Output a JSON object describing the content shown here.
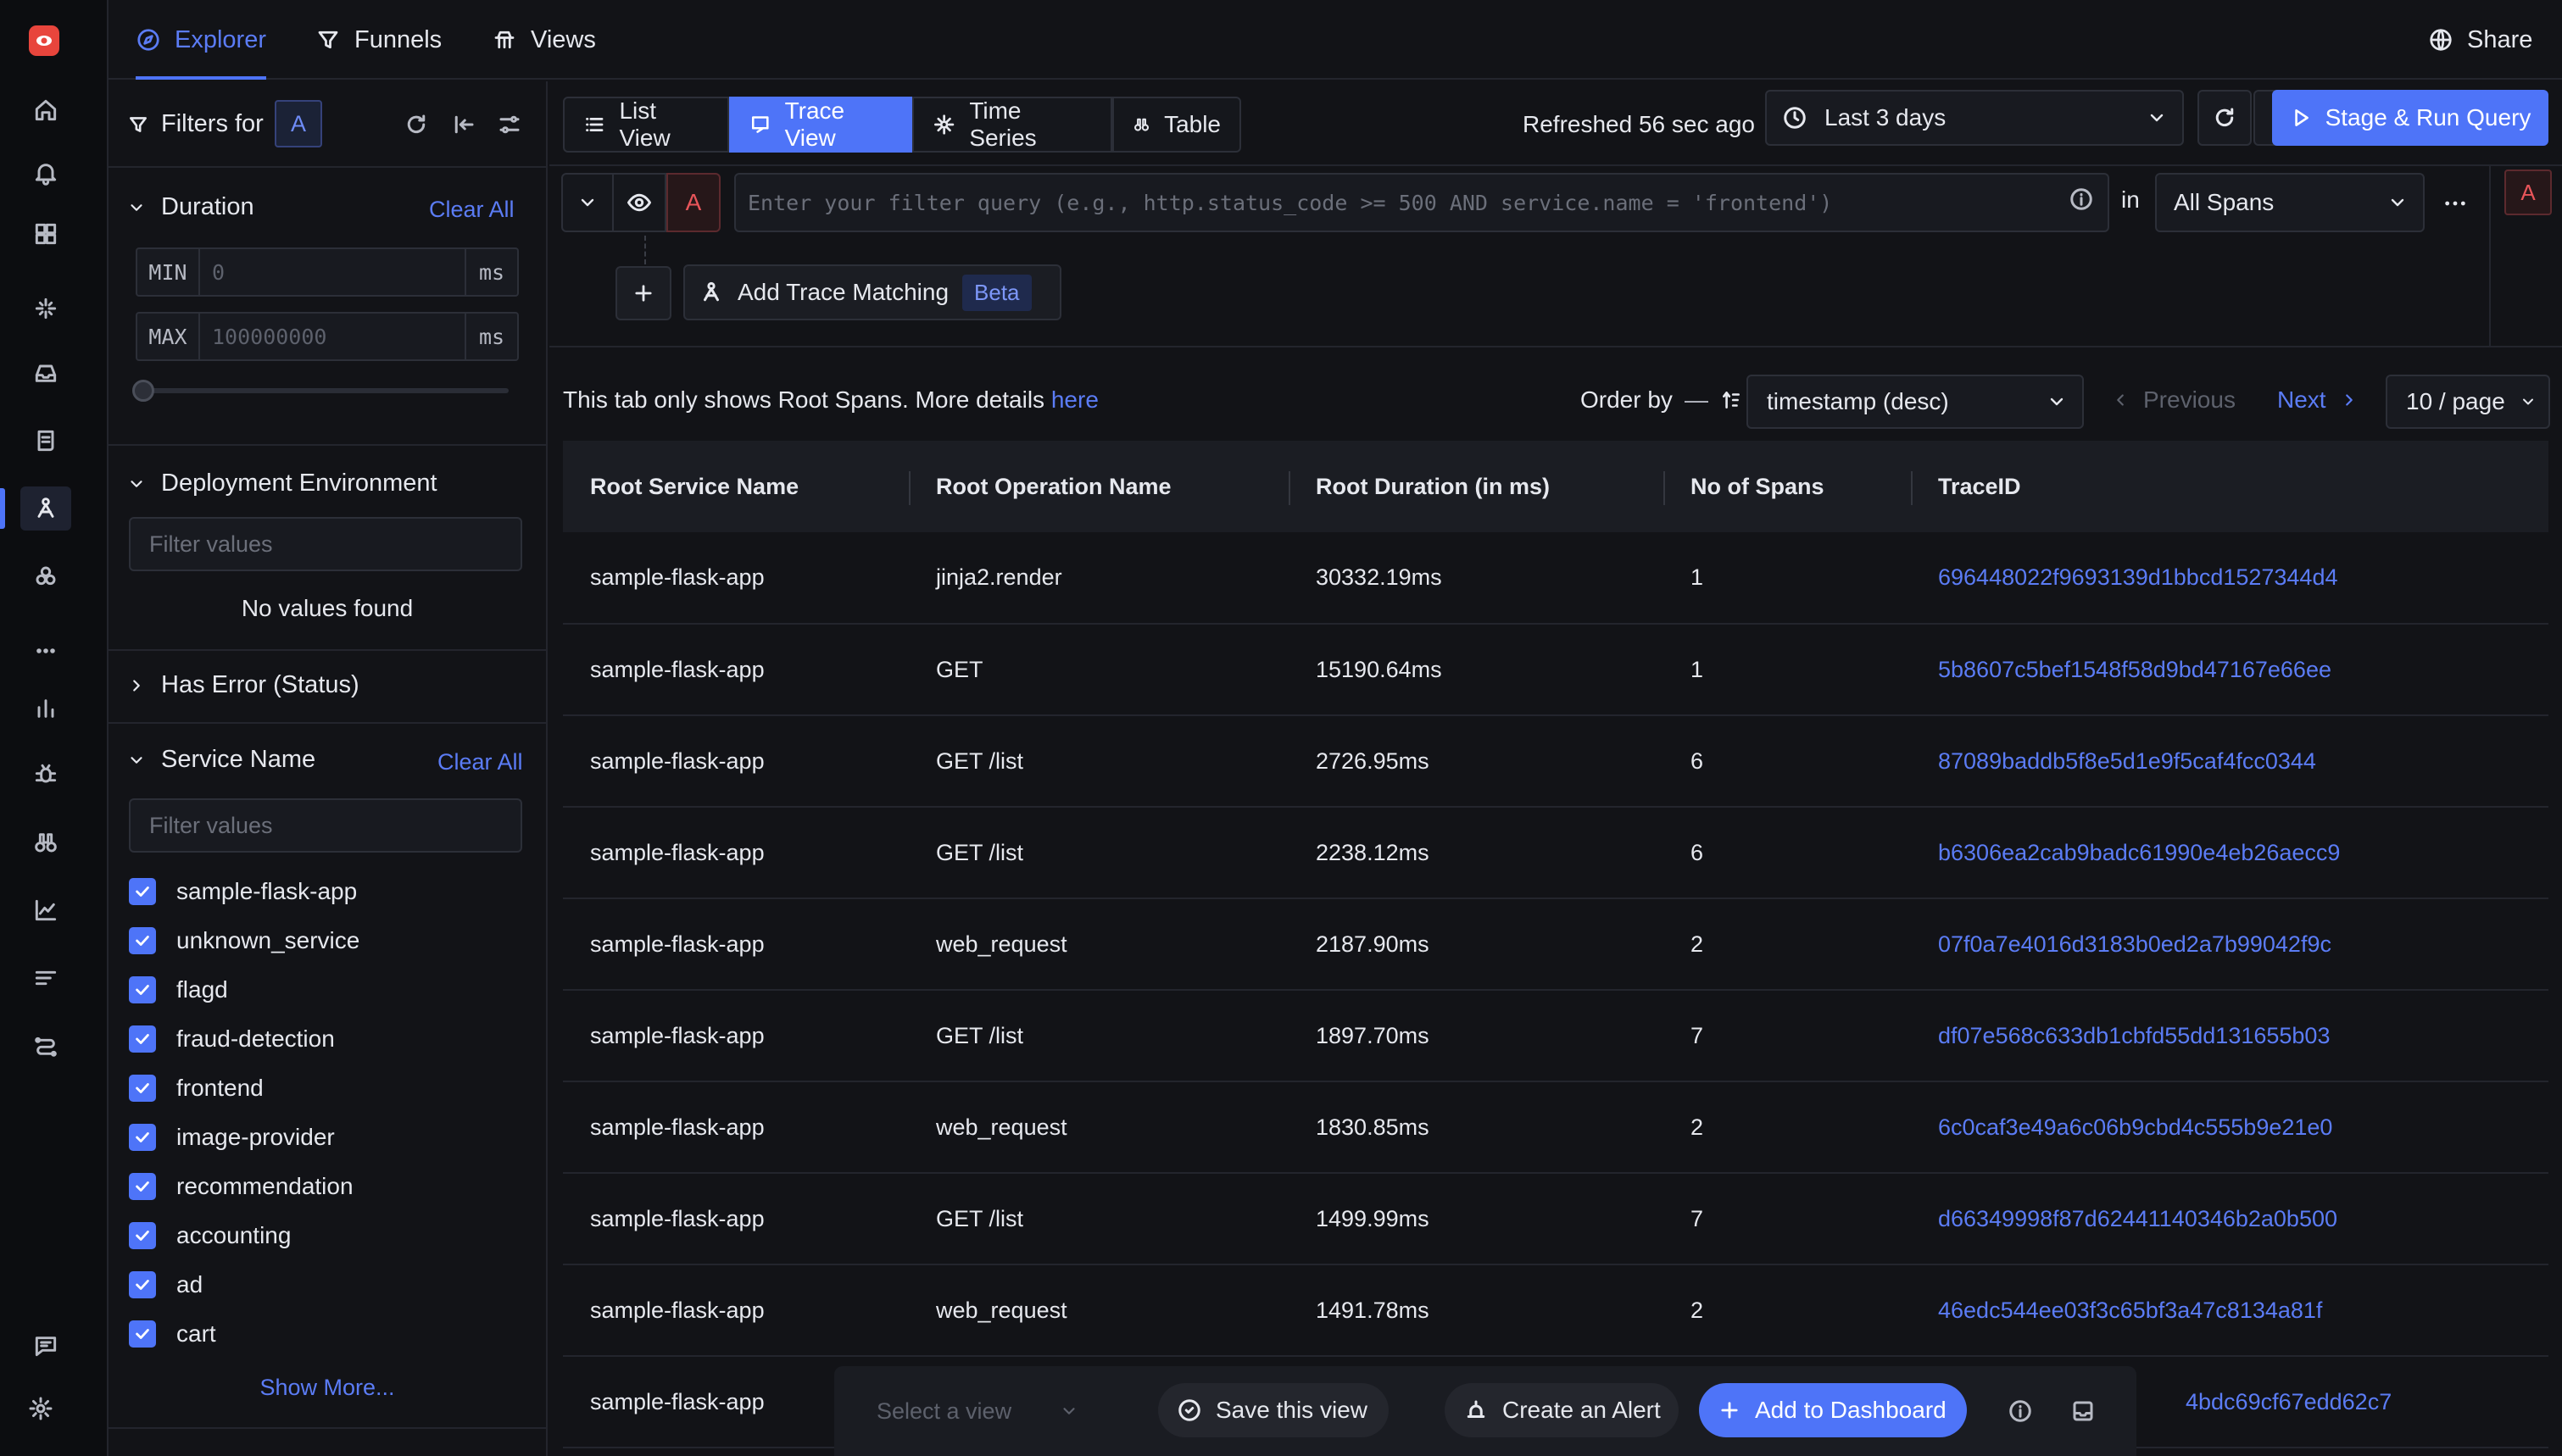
{
  "nav": {
    "tabs": [
      {
        "label": "Explorer",
        "icon": "compass-icon"
      },
      {
        "label": "Funnels",
        "icon": "funnel-icon"
      },
      {
        "label": "Views",
        "icon": "views-icon"
      }
    ],
    "share_label": "Share"
  },
  "filters": {
    "title": "Filters for",
    "query_badge": "A",
    "duration": {
      "title": "Duration",
      "clear_label": "Clear All",
      "min_label": "MIN",
      "min_placeholder": "0",
      "min_unit": "ms",
      "max_label": "MAX",
      "max_placeholder": "100000000",
      "max_unit": "ms"
    },
    "deployment": {
      "title": "Deployment Environment",
      "placeholder": "Filter values",
      "empty_text": "No values found"
    },
    "has_error": {
      "title": "Has Error (Status)"
    },
    "service": {
      "title": "Service Name",
      "clear_label": "Clear All",
      "placeholder": "Filter values",
      "items": [
        "sample-flask-app",
        "unknown_service",
        "flagd",
        "fraud-detection",
        "frontend",
        "image-provider",
        "recommendation",
        "accounting",
        "ad",
        "cart"
      ],
      "show_more": "Show More..."
    }
  },
  "toolbar": {
    "view_tabs": [
      {
        "label": "List View",
        "icon": "list-icon"
      },
      {
        "label": "Trace View",
        "icon": "trace-icon"
      },
      {
        "label": "Time Series",
        "icon": "time-series-icon"
      },
      {
        "label": "Table",
        "icon": "table-icon"
      }
    ],
    "refreshed": "Refreshed 56 sec ago",
    "time_range": "Last 3 days",
    "run_label": "Stage & Run Query"
  },
  "query": {
    "badge": "A",
    "placeholder": "Enter your filter query (e.g., http.status_code >= 500 AND service.name = 'frontend')",
    "in_label": "in",
    "span_scope": "All Spans",
    "add_trace_label": "Add Trace Matching",
    "beta_label": "Beta",
    "side_badge": "A"
  },
  "results": {
    "notice": "This tab only shows Root Spans. More details",
    "notice_link": "here",
    "order_label": "Order by",
    "order_value": "timestamp (desc)",
    "prev_label": "Previous",
    "next_label": "Next",
    "page_size": "10 / page",
    "columns": [
      "Root Service Name",
      "Root Operation Name",
      "Root Duration (in ms)",
      "No of Spans",
      "TraceID"
    ],
    "rows": [
      [
        "sample-flask-app",
        "jinja2.render",
        "30332.19ms",
        "1",
        "696448022f9693139d1bbcd1527344d4"
      ],
      [
        "sample-flask-app",
        "GET",
        "15190.64ms",
        "1",
        "5b8607c5bef1548f58d9bd47167e66ee"
      ],
      [
        "sample-flask-app",
        "GET /list",
        "2726.95ms",
        "6",
        "87089baddb5f8e5d1e9f5caf4fcc0344"
      ],
      [
        "sample-flask-app",
        "GET /list",
        "2238.12ms",
        "6",
        "b6306ea2cab9badc61990e4eb26aecc9"
      ],
      [
        "sample-flask-app",
        "web_request",
        "2187.90ms",
        "2",
        "07f0a7e4016d3183b0ed2a7b99042f9c"
      ],
      [
        "sample-flask-app",
        "GET /list",
        "1897.70ms",
        "7",
        "df07e568c633db1cbfd55dd131655b03"
      ],
      [
        "sample-flask-app",
        "web_request",
        "1830.85ms",
        "2",
        "6c0caf3e49a6c06b9cbd4c555b9e21e0"
      ],
      [
        "sample-flask-app",
        "GET /list",
        "1499.99ms",
        "7",
        "d66349998f87d62441140346b2a0b500"
      ],
      [
        "sample-flask-app",
        "web_request",
        "1491.78ms",
        "2",
        "46edc544ee03f3c65bf3a47c8134a81f"
      ],
      [
        "sample-flask-app",
        "",
        "",
        "",
        "4bdc69cf67edd62c7"
      ]
    ]
  },
  "bottom": {
    "select_placeholder": "Select a view",
    "save_label": "Save this view",
    "alert_label": "Create an Alert",
    "dashboard_label": "Add to Dashboard"
  },
  "colors": {
    "accent": "#4e74f8",
    "link": "#5b7cf5",
    "background": "#121317"
  }
}
